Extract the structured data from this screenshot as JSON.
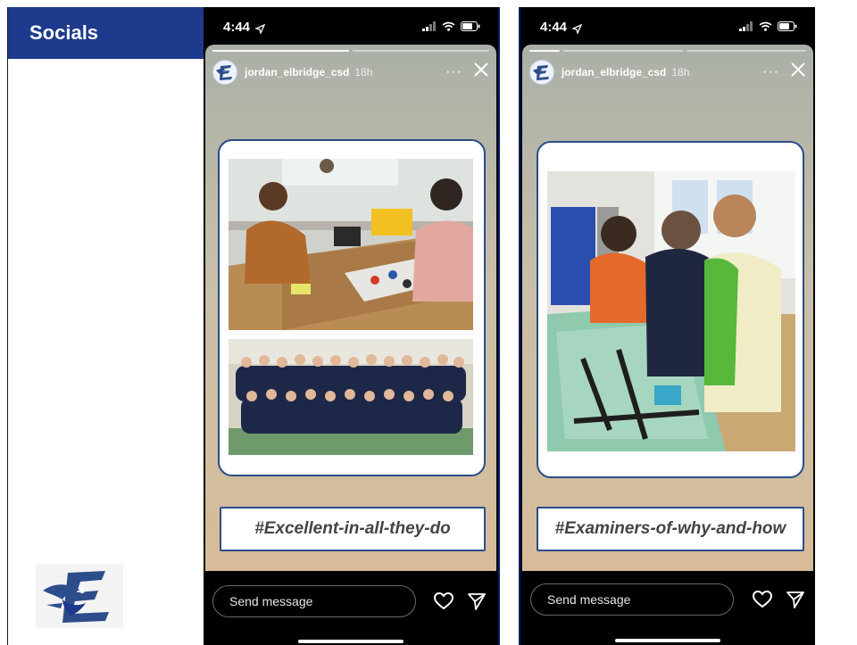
{
  "sidebar": {
    "title": "Socials"
  },
  "stories": [
    {
      "time": "4:44",
      "username": "jordan_elbridge_csd",
      "age": "18h",
      "caption": "#Excellent-in-all-they-do",
      "message_placeholder": "Send message"
    },
    {
      "time": "4:44",
      "username": "jordan_elbridge_csd",
      "age": "18h",
      "caption": "#Examiners-of-why-and-how",
      "message_placeholder": "Send message"
    }
  ],
  "colors": {
    "header": "#1e3a8c",
    "card_border": "#2c4d8a"
  },
  "icons": [
    "location-arrow-icon",
    "signal-icon",
    "wifi-icon",
    "battery-icon",
    "more-icon",
    "close-icon",
    "heart-icon",
    "send-icon",
    "eagle-logo-icon"
  ]
}
